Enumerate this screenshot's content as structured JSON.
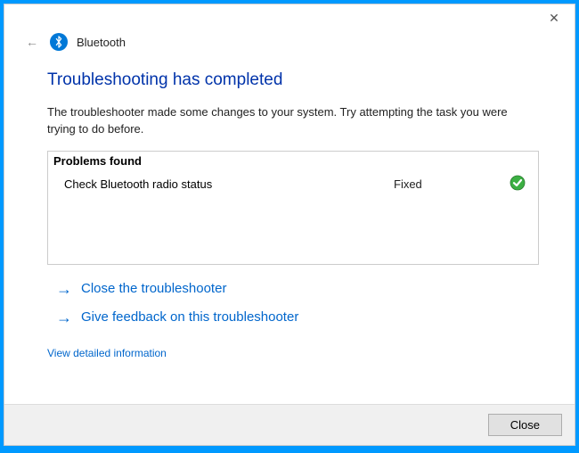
{
  "titlebar": {
    "close_glyph": "✕"
  },
  "header": {
    "back_glyph": "←",
    "app_title": "Bluetooth"
  },
  "heading": "Troubleshooting has completed",
  "description": "The troubleshooter made some changes to your system. Try attempting the task you were trying to do before.",
  "problems": {
    "header": "Problems found",
    "items": [
      {
        "name": "Check Bluetooth radio status",
        "status": "Fixed"
      }
    ]
  },
  "actions": {
    "arrow_glyph": "→",
    "close_troubleshooter": "Close the troubleshooter",
    "give_feedback": "Give feedback on this troubleshooter"
  },
  "detail_link": "View detailed information",
  "buttons": {
    "close": "Close"
  }
}
